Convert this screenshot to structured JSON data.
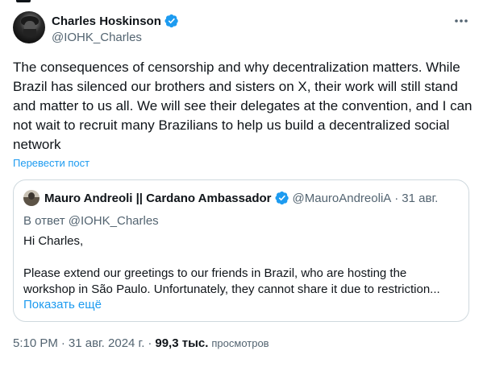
{
  "author": {
    "name": "Charles Hoskinson",
    "handle": "@IOHK_Charles"
  },
  "tweet": {
    "text": "The consequences of censorship and why decentralization matters. While Brazil has silenced our brothers and sisters on X, their work will still stand and matter to us all. We will see their delegates at the convention, and I can not wait to recruit many Brazilians to help us build a decentralized social network",
    "translate_label": "Перевести пост"
  },
  "quote": {
    "name": "Mauro Andreoli || Cardano Ambassador",
    "handle": "@MauroAndreoliA",
    "dot": "·",
    "date": "31 авг.",
    "reply_prefix": "В ответ",
    "reply_to": "@IOHK_Charles",
    "greeting": "Hi Charles,",
    "line1": "Please extend our greetings to our friends in Brazil, who are hosting the",
    "line2": "workshop in São Paulo. Unfortunately, they cannot share it due to restriction...",
    "show_more": "Показать ещё"
  },
  "meta": {
    "time": "5:10 PM",
    "sep1": "·",
    "date": "31 авг. 2024 г.",
    "sep2": "·",
    "views_count": "99,3 тыс.",
    "views_label": "просмотров"
  },
  "colors": {
    "accent": "#1d9bf0",
    "text": "#0f1419",
    "secondary": "#536471",
    "border": "#cfd9de"
  },
  "icons": {
    "verified": "verified-badge-icon",
    "more": "more-dots-icon"
  }
}
